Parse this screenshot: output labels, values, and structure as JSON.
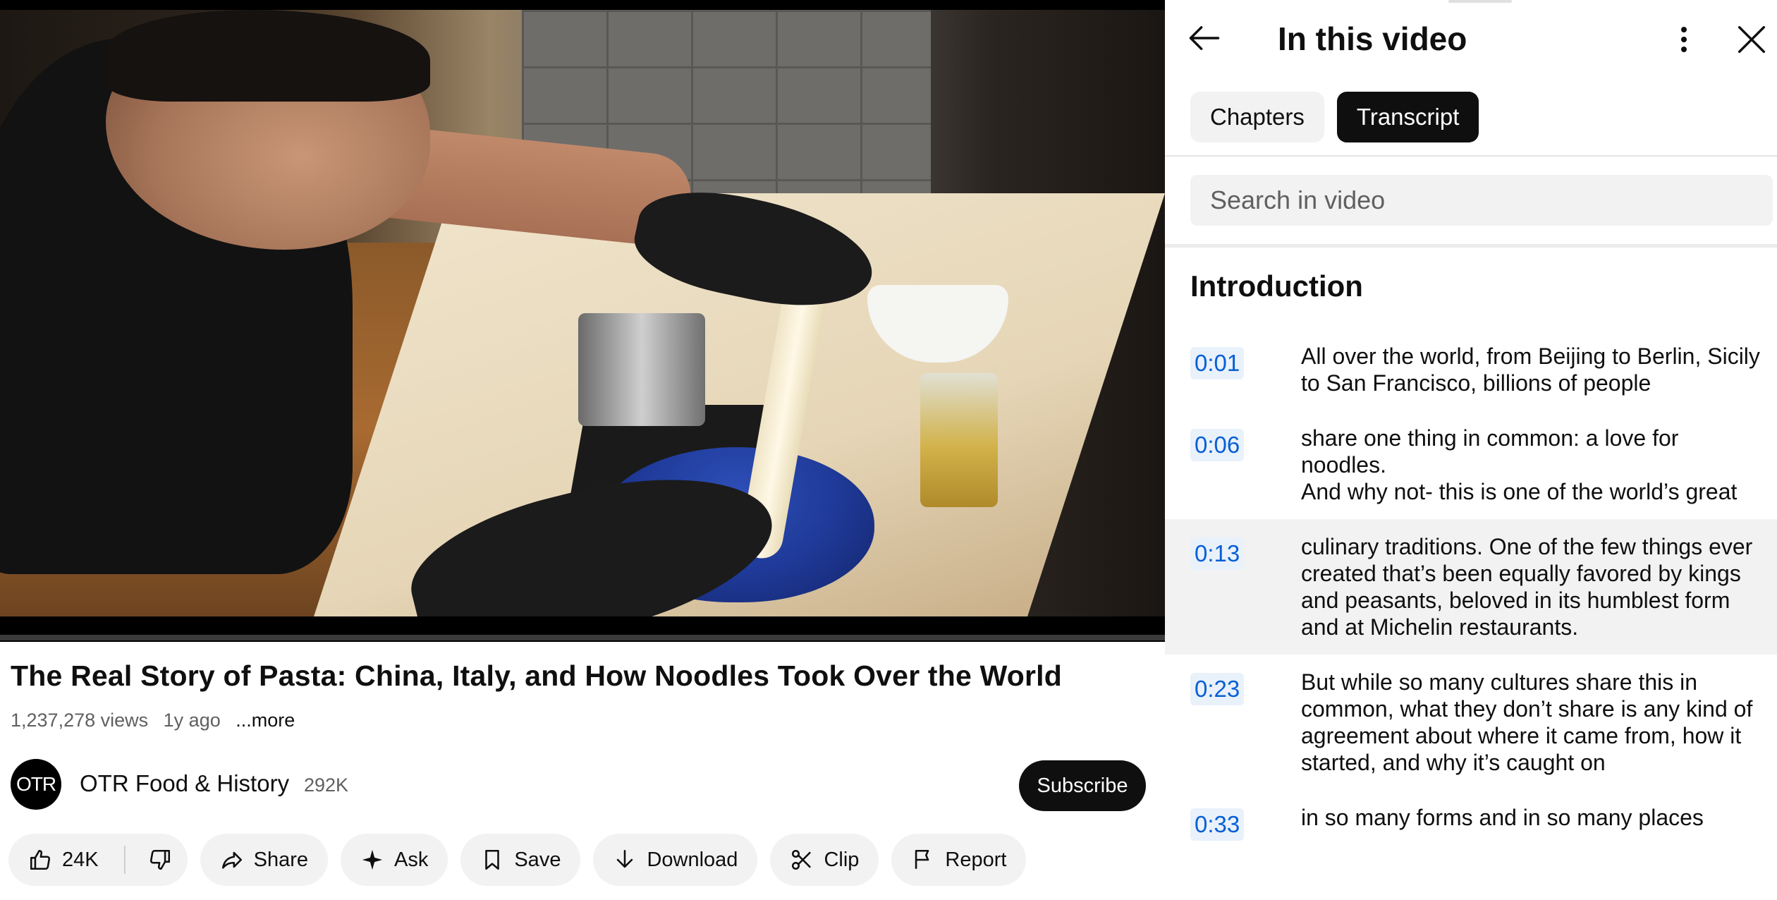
{
  "video": {
    "title": "The Real Story of Pasta: China, Italy, and How Noodles Took Over the World",
    "views": "1,237,278 views",
    "age": "1y ago",
    "more_label": "...more"
  },
  "channel": {
    "avatar_text": "OTR",
    "name": "OTR Food & History",
    "subscribers": "292K",
    "subscribe_label": "Subscribe"
  },
  "actions": {
    "like_count": "24K",
    "share_label": "Share",
    "ask_label": "Ask",
    "save_label": "Save",
    "download_label": "Download",
    "clip_label": "Clip",
    "report_label": "Report"
  },
  "panel": {
    "title": "In this video",
    "tabs": [
      {
        "label": "Chapters",
        "active": false
      },
      {
        "label": "Transcript",
        "active": true
      }
    ],
    "search_placeholder": "Search in video",
    "section_title": "Introduction",
    "segments": [
      {
        "time": "0:01",
        "text": "All over the world, from Beijing to Berlin, Sicily to San Francisco, billions of people",
        "highlighted": false
      },
      {
        "time": "0:06",
        "text": "share one thing in common: a love for noodles.\nAnd why not- this is one of the world’s great",
        "highlighted": false
      },
      {
        "time": "0:13",
        "text": "culinary traditions. One of the few things ever created that’s been equally favored by kings and peasants, beloved in its humblest form and at Michelin restaurants.",
        "highlighted": true
      },
      {
        "time": "0:23",
        "text": "But while so many cultures share this in common, what they don’t share is any kind of agreement about where it came from, how it started, and why it’s caught on",
        "highlighted": false
      },
      {
        "time": "0:33",
        "text": "in so many forms and in so many places",
        "highlighted": false
      }
    ]
  },
  "colors": {
    "accent_timestamp": "#065fd4",
    "subscribe_bg": "#0f0f0f",
    "active_tab_bg": "#0f0f0f",
    "pill_bg": "#f2f2f2"
  }
}
